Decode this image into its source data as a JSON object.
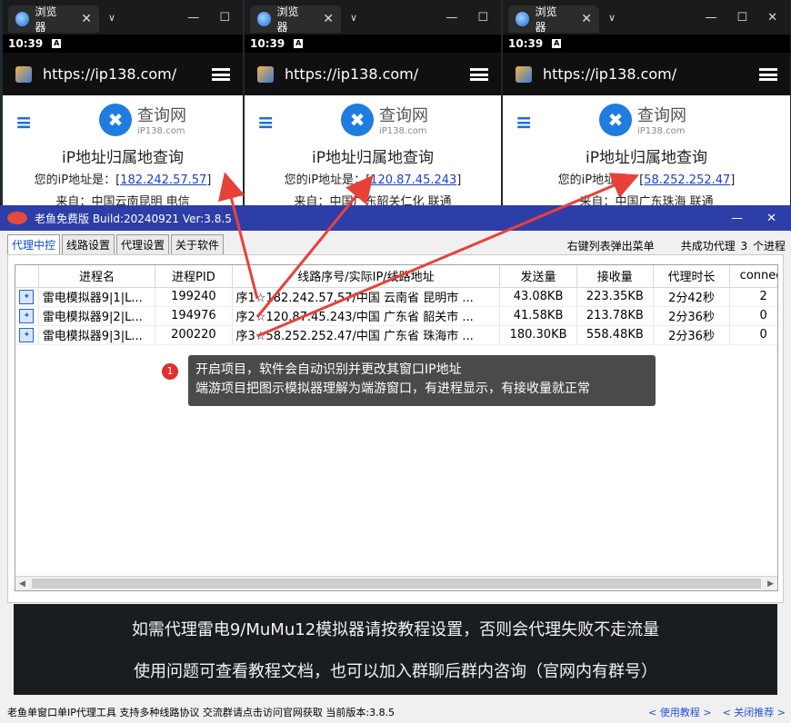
{
  "browsers": [
    {
      "tab_title": "浏览器",
      "time": "10:39",
      "url": "https://ip138.com/",
      "logo_title": "查询网",
      "logo_sub": "iP138.com",
      "page_title": "iP地址归属地查询",
      "ip_label": "您的iP地址是：",
      "ip": "182.242.57.57",
      "from_label": "来自：",
      "from": "中国云南昆明 电信"
    },
    {
      "tab_title": "浏览器",
      "time": "10:39",
      "url": "https://ip138.com/",
      "logo_title": "查询网",
      "logo_sub": "iP138.com",
      "page_title": "iP地址归属地查询",
      "ip_label": "您的iP地址是：",
      "ip": "120.87.45.243",
      "from_label": "来自：",
      "from": "中国广东韶关仁化 联通"
    },
    {
      "tab_title": "浏览器",
      "time": "10:39",
      "url": "https://ip138.com/",
      "logo_title": "查询网",
      "logo_sub": "iP138.com",
      "page_title": "iP地址归属地查询",
      "ip_label": "您的iP地址是：",
      "ip": "58.252.252.47",
      "from_label": "来自：",
      "from": "中国广东珠海 联通"
    }
  ],
  "app": {
    "title": "老鱼免费版 Build:20240921 Ver:3.8.5",
    "tabs": [
      "代理中控",
      "线路设置",
      "代理设置",
      "关于软件"
    ],
    "right_hint": "右键列表弹出菜单",
    "success_info": "共成功代理 3 个进程",
    "columns": [
      "进程名",
      "进程PID",
      "线路序号/实际IP/线路地址",
      "发送量",
      "接收量",
      "代理时长",
      "connect"
    ],
    "rows": [
      {
        "name": "雷电模拟器9|1|L...",
        "pid": "199240",
        "line": "序1☆182.242.57.57/中国 云南省 昆明市 ...",
        "sent": "43.08KB",
        "recv": "223.35KB",
        "duration": "2分42秒",
        "connect": "2"
      },
      {
        "name": "雷电模拟器9|2|L...",
        "pid": "194976",
        "line": "序2☆120.87.45.243/中国 广东省 韶关市 ...",
        "sent": "41.58KB",
        "recv": "213.78KB",
        "duration": "2分36秒",
        "connect": "0"
      },
      {
        "name": "雷电模拟器9|3|L...",
        "pid": "200220",
        "line": "序3☆58.252.252.47/中国 广东省 珠海市 ...",
        "sent": "180.30KB",
        "recv": "558.48KB",
        "duration": "2分36秒",
        "connect": "0"
      }
    ],
    "tooltip_badge": "1",
    "tooltip_line1": "开启项目，软件会自动识别并更改其窗口IP地址",
    "tooltip_line2": "端游项目把图示模拟器理解为端游窗口，有进程显示，有接收量就正常",
    "notice_line1": "如需代理雷电9/MuMu12模拟器请按教程设置，否则会代理失败不走流量",
    "notice_line2": "使用问题可查看教程文档，也可以加入群聊后群内咨询（官网内有群号）",
    "footer_text": "老鱼单窗口单IP代理工具 支持多种线路协议 交流群请点击访问官网获取  当前版本:3.8.5",
    "footer_link1": "< 使用教程 >",
    "footer_link2": "< 关闭推荐 >"
  },
  "colors": {
    "accent_title": "#2d3ea8",
    "arrow": "#e8413a",
    "link": "#1b3fd1"
  }
}
